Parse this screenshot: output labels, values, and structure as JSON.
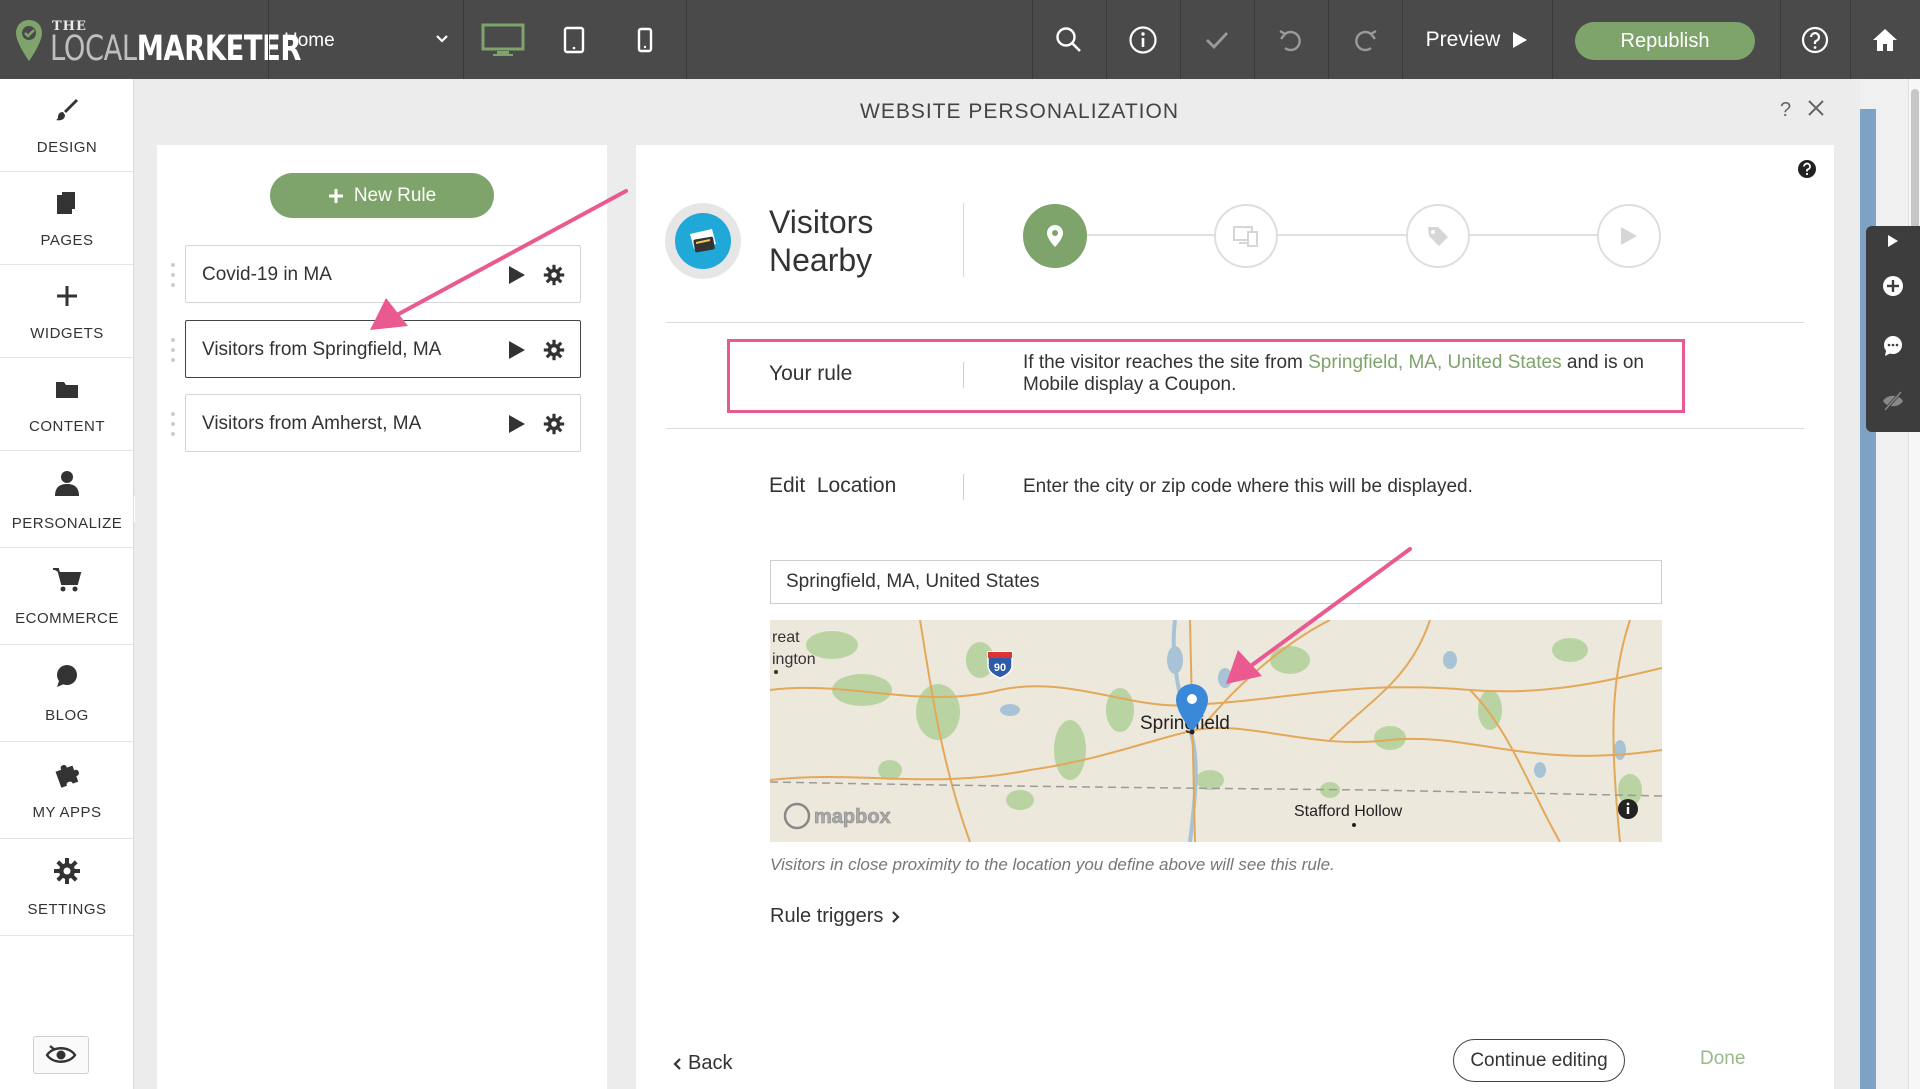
{
  "brand": {
    "logo_the": "THE",
    "logo_local": "LOCAL",
    "logo_marketer": "MARKETER",
    "accent": "#7ea46b",
    "highlight": "#ea5a90"
  },
  "topbar": {
    "page_select": "Home",
    "preview_label": "Preview",
    "republish_label": "Republish"
  },
  "sidebar": {
    "items": [
      {
        "label": "DESIGN",
        "icon": "brush-icon"
      },
      {
        "label": "PAGES",
        "icon": "pages-icon"
      },
      {
        "label": "WIDGETS",
        "icon": "plus-icon"
      },
      {
        "label": "CONTENT",
        "icon": "folder-icon"
      },
      {
        "label": "PERSONALIZE",
        "icon": "user-icon"
      },
      {
        "label": "ECOMMERCE",
        "icon": "cart-icon"
      },
      {
        "label": "BLOG",
        "icon": "chat-icon"
      },
      {
        "label": "MY APPS",
        "icon": "puzzle-icon"
      },
      {
        "label": "SETTINGS",
        "icon": "gear-icon"
      }
    ]
  },
  "modal": {
    "title": "WEBSITE PERSONALIZATION",
    "help": "?"
  },
  "rules": {
    "new_rule_label": "New Rule",
    "items": [
      {
        "label": "Covid-19 in MA"
      },
      {
        "label": "Visitors from Springfield, MA"
      },
      {
        "label": "Visitors from Amherst, MA"
      }
    ]
  },
  "detail": {
    "title": "Visitors Nearby",
    "your_rule_label": "Your rule",
    "rule_text_1": "If the visitor reaches the site from ",
    "rule_text_location": "Springfield, MA, United States",
    "rule_text_2": " and is on Mobile display a Coupon.",
    "edit_label": "Edit  Location",
    "edit_hint": "Enter the city or zip code where this will be displayed.",
    "location_value": "Springfield, MA, United States",
    "map": {
      "labels": {
        "city": "Springfield",
        "town": "Stafford Hollow",
        "edge1": "reat",
        "edge2": "ington",
        "route": "90",
        "attribution": "mapbox"
      }
    },
    "map_caption": "Visitors in close proximity to the location you define above will see this rule.",
    "triggers_label": "Rule triggers",
    "back_label": "Back",
    "continue_label": "Continue editing",
    "done_label": "Done"
  }
}
